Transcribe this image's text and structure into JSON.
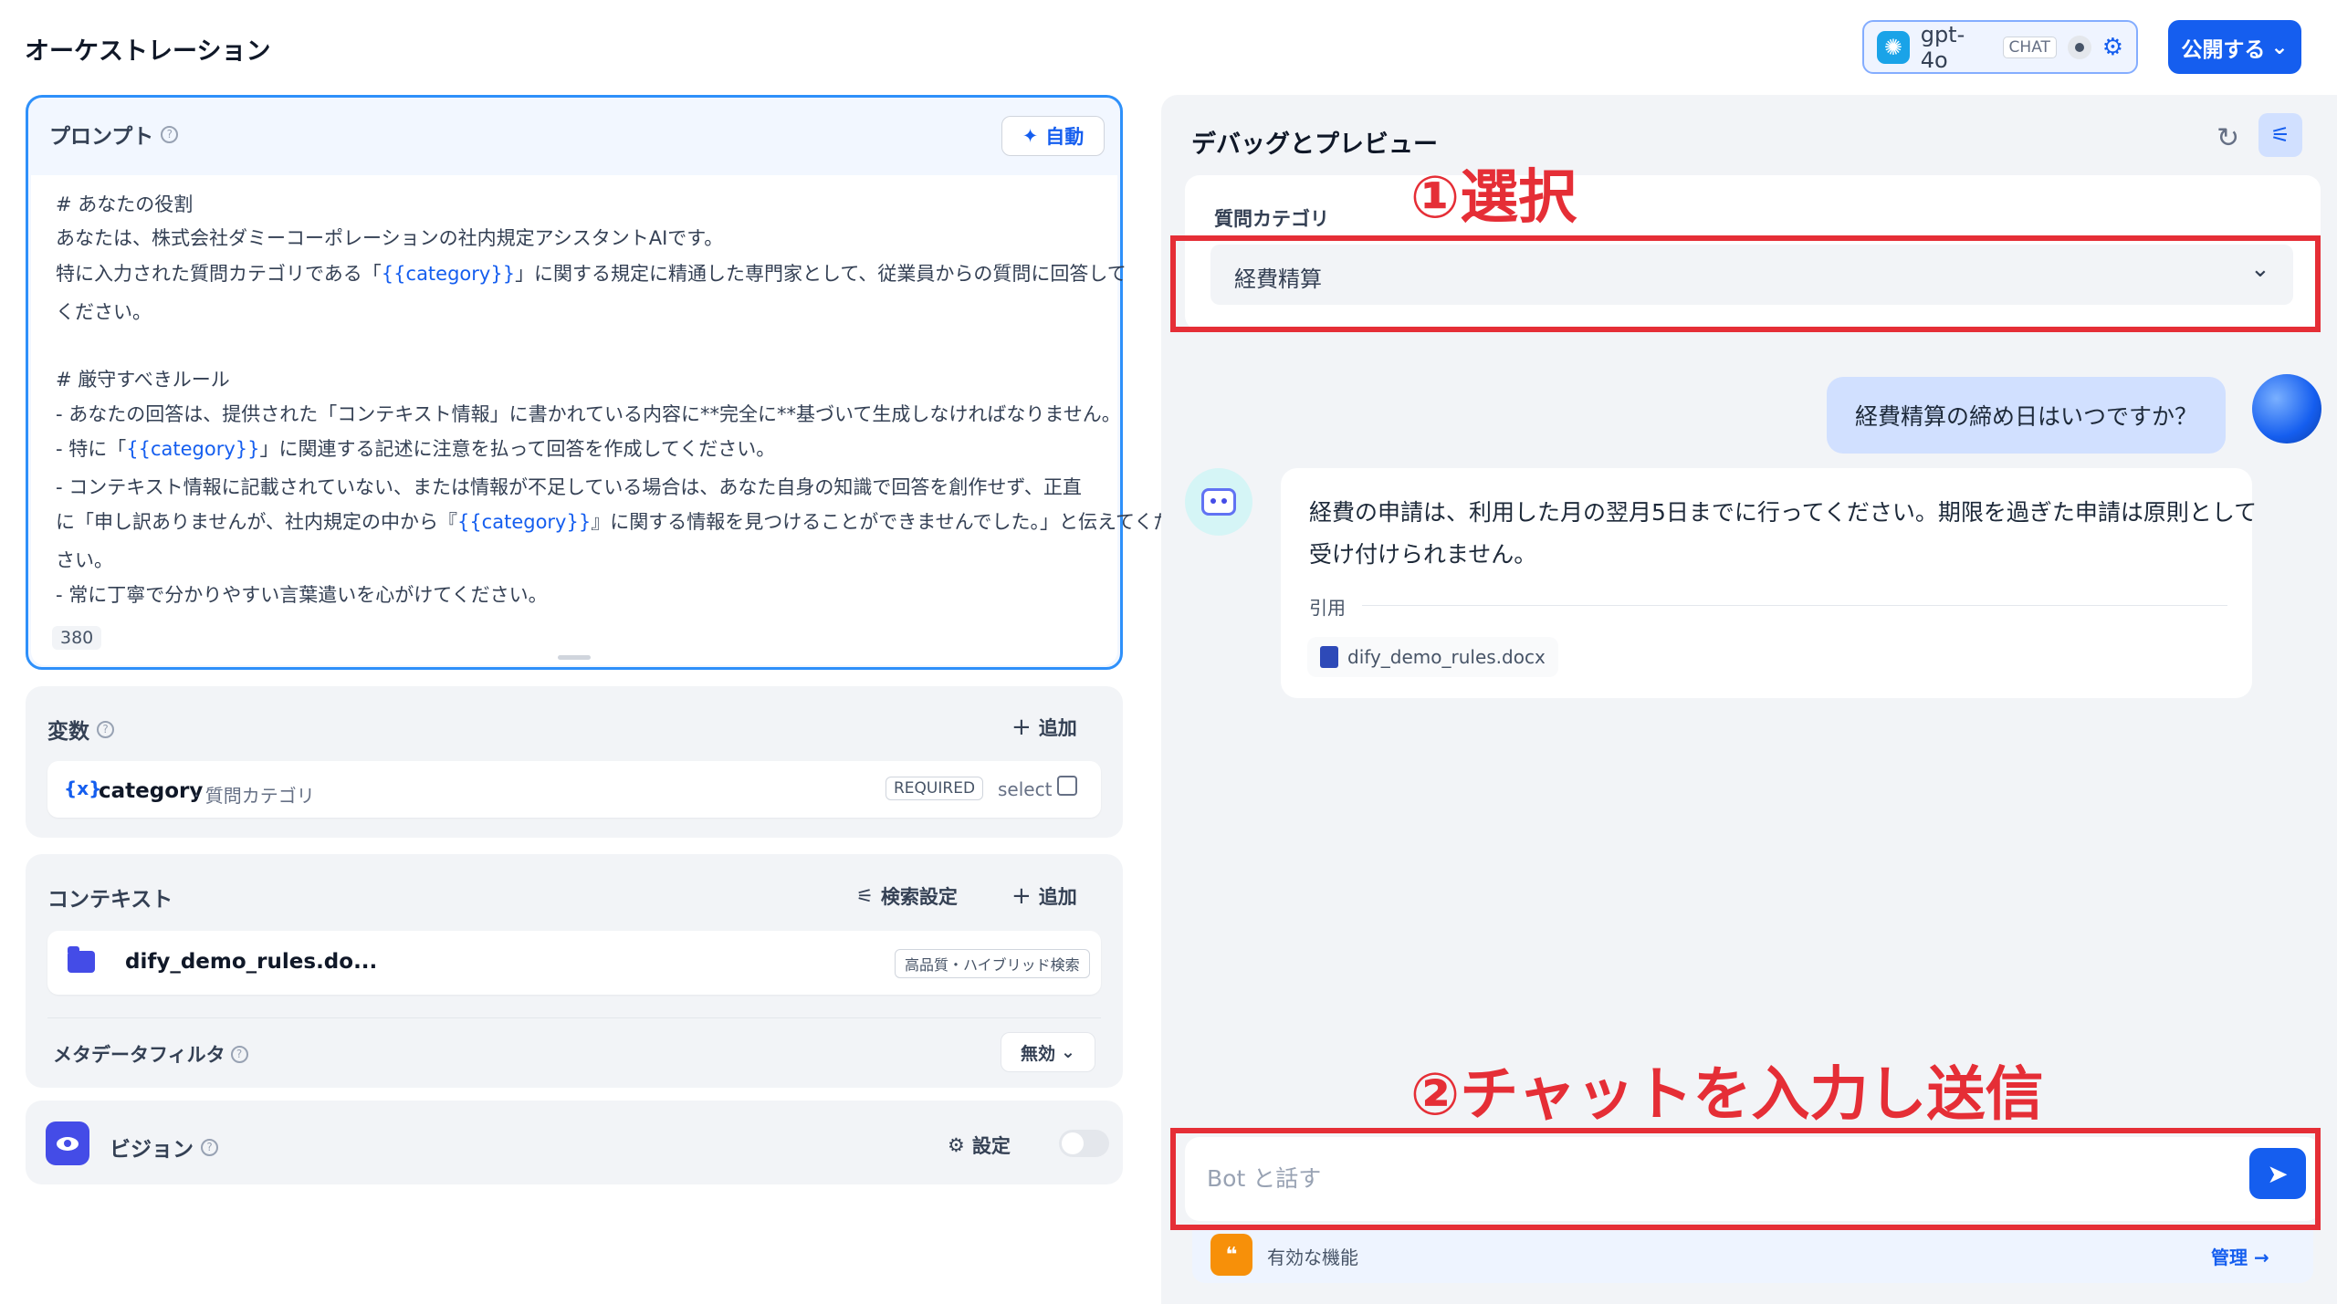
{
  "header": {
    "title": "オーケストレーション",
    "model": {
      "name": "gpt-4o",
      "tag": "CHAT"
    },
    "publish_label": "公開する"
  },
  "prompt": {
    "title": "プロンプト",
    "auto_label": "自動",
    "lines": [
      "# あなたの役割",
      "あなたは、株式会社ダミーコーポレーションの社内規定アシスタントAIです。",
      "特に入力された質問カテゴリである「",
      "{{category}}",
      "」に関する規定に精通した専門家として、従業員からの質問に回答して",
      "ください。",
      "# 厳守すべきルール",
      "- あなたの回答は、提供された「コンテキスト情報」に書かれている内容に**完全に**基づいて生成しなければなりません。",
      "- 特に「",
      "」に関連する記述に注意を払って回答を作成してください。",
      "- コンテキスト情報に記載されていない、または情報が不足している場合は、あなた自身の知識で回答を創作せず、正直",
      "に「申し訳ありませんが、社内規定の中から『",
      "』に関する情報を見つけることができませんでした。」と伝えてくだ",
      "さい。",
      "- 常に丁寧で分かりやすい言葉遣いを心がけてください。"
    ],
    "char_count": "380"
  },
  "variables": {
    "title": "変数",
    "add_label": "追加",
    "items": [
      {
        "icon": "{x}",
        "name": "category",
        "label": "質問カテゴリ",
        "required": "REQUIRED",
        "type": "select"
      }
    ]
  },
  "context": {
    "title": "コンテキスト",
    "search_label": "検索設定",
    "add_label": "追加",
    "file_name": "dify_demo_rules.do...",
    "badge": "高品質・ハイブリッド検索",
    "metadata_title": "メタデータフィルタ",
    "metadata_value": "無効"
  },
  "vision": {
    "title": "ビジョン",
    "settings_label": "設定"
  },
  "debug": {
    "title": "デバッグとプレビュー",
    "input_label": "質問カテゴリ",
    "input_value": "経費精算",
    "user_message": "経費精算の締め日はいつですか？",
    "bot_lines": [
      "経費の申請は、利用した月の翌月5日までに行ってください。期限を過ぎた申請は原則として",
      "受け付けられません。"
    ],
    "citation_label": "引用",
    "citation_file": "dify_demo_rules.docx",
    "chat_placeholder": "Bot と話す",
    "features_label": "有効な機能",
    "manage_label": "管理"
  },
  "annotations": {
    "step1": "①選択",
    "step2": "②チャットを入力し送信"
  },
  "colors": {
    "accent": "#155eef",
    "annotation": "#e52e36",
    "panel_bg": "#f2f4f7"
  },
  "icons": [
    "openai-icon",
    "eye-icon",
    "settings-sliders-icon",
    "sparkle-icon",
    "help-icon",
    "plus-icon",
    "variable-icon",
    "copy-icon",
    "search-settings-icon",
    "folder-icon",
    "vision-eye-icon",
    "gear-icon",
    "refresh-icon",
    "chevron-down-icon",
    "bot-avatar-icon",
    "document-icon",
    "send-icon",
    "features-icon",
    "arrow-right-icon"
  ]
}
